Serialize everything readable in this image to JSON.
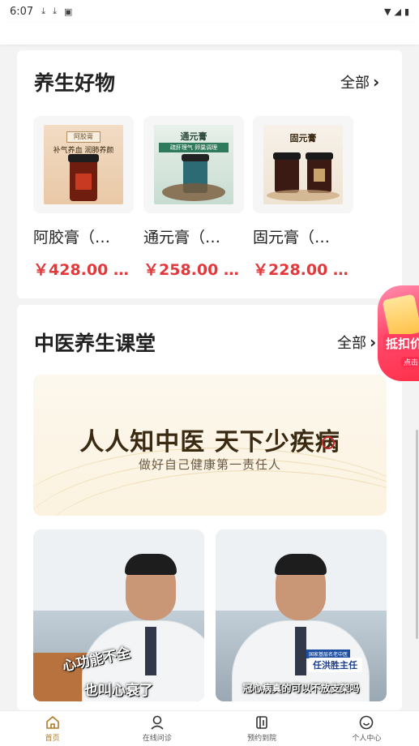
{
  "status_bar": {
    "time": "6:07"
  },
  "goods": {
    "title": "养生好物",
    "see_all": "全部",
    "products": [
      {
        "name": "阿胶膏（…",
        "price": "￥428.00 …",
        "label": "阿胶膏",
        "slogan": "补气养血 润肺养颜"
      },
      {
        "name": "通元膏（…",
        "price": "￥258.00 …",
        "label": "通元膏",
        "slogan": "疏肝理气 卵巢调理"
      },
      {
        "name": "固元膏（…",
        "price": "￥228.00 …",
        "label": "固元膏"
      }
    ]
  },
  "classroom": {
    "title": "中医养生课堂",
    "see_all": "全部",
    "banner": {
      "headline": "人人知中医 天下少疾病",
      "subline": "做好自己健康第一责任人"
    },
    "videos": [
      {
        "caption_top": "心功能不全",
        "caption_bottom": "也叫心衰了"
      },
      {
        "tag_small": "国家基层名老中医",
        "tag_name": "任洪胜主任",
        "caption_bottom": "冠心病真的可以不放支架吗"
      }
    ]
  },
  "float_badge": {
    "text": "抵扣价",
    "sub": "点击"
  },
  "bottom_nav": [
    {
      "label": "首页",
      "icon": "home-icon",
      "active": true
    },
    {
      "label": "在线问诊",
      "icon": "consult-icon",
      "active": false
    },
    {
      "label": "预约到院",
      "icon": "appointment-icon",
      "active": false
    },
    {
      "label": "个人中心",
      "icon": "profile-icon",
      "active": false
    }
  ],
  "colors": {
    "price": "#e4393c",
    "nav_active": "#b07a2a",
    "badge": "#ff3e5f"
  }
}
